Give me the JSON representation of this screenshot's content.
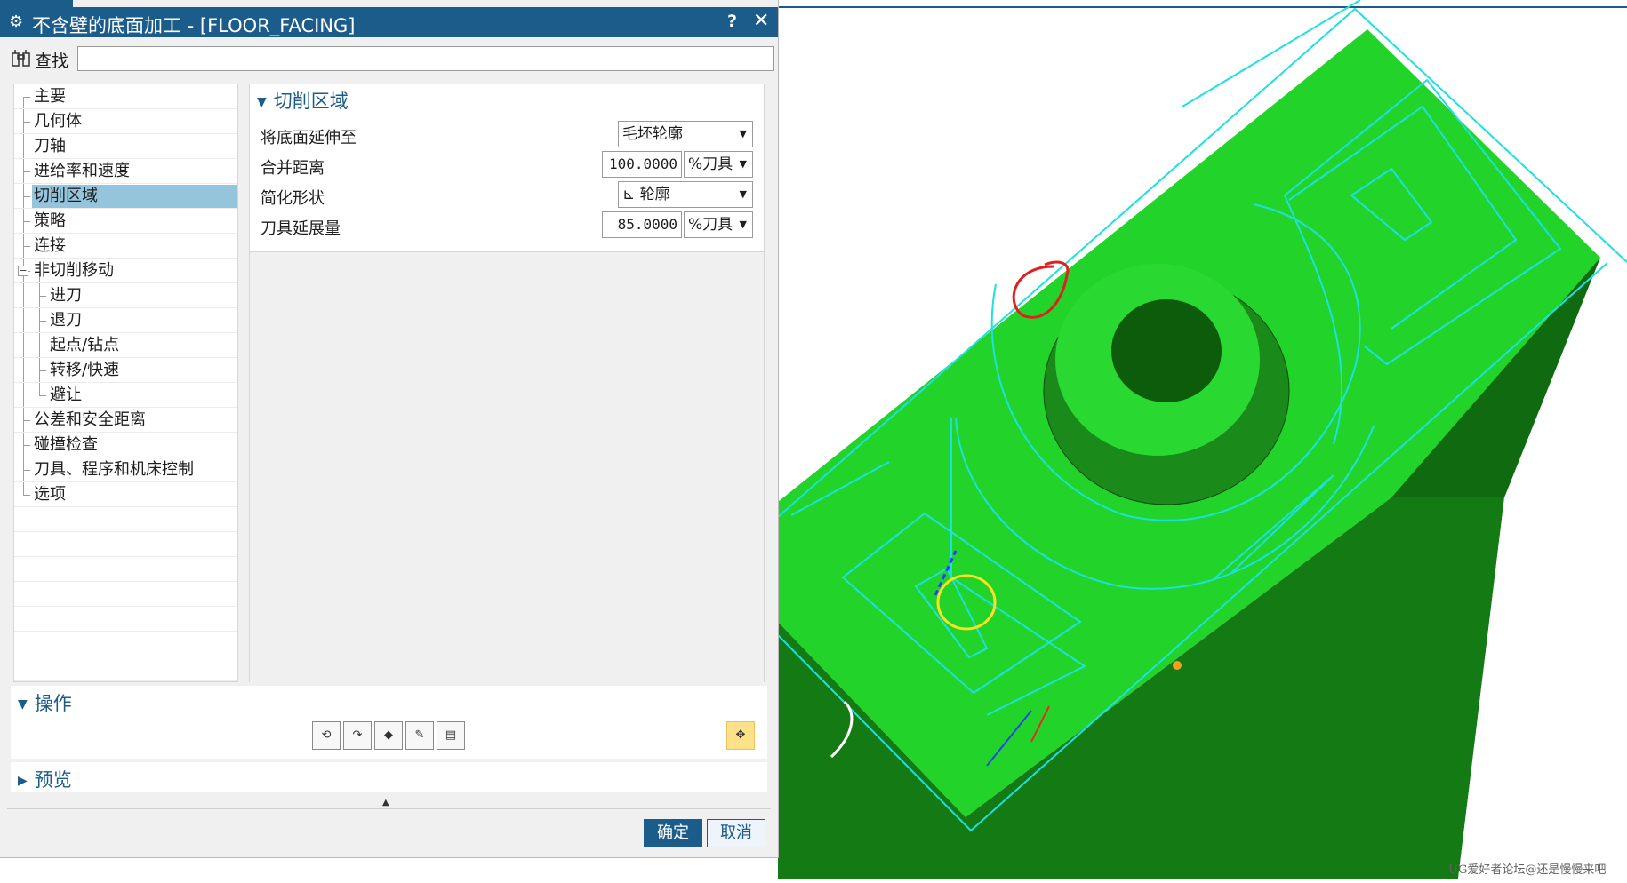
{
  "dialog": {
    "title": "不含壁的底面加工 - [FLOOR_FACING]",
    "help_label": "?",
    "close_label": "✕"
  },
  "find": {
    "label": "查找",
    "value": ""
  },
  "nav": {
    "items": [
      {
        "label": "主要",
        "level": 1
      },
      {
        "label": "几何体",
        "level": 1
      },
      {
        "label": "刀轴",
        "level": 1
      },
      {
        "label": "进给率和速度",
        "level": 1
      },
      {
        "label": "切削区域",
        "level": 1,
        "selected": true
      },
      {
        "label": "策略",
        "level": 1
      },
      {
        "label": "连接",
        "level": 1
      },
      {
        "label": "非切削移动",
        "level": 1,
        "expanded": true
      },
      {
        "label": "进刀",
        "level": 2
      },
      {
        "label": "退刀",
        "level": 2
      },
      {
        "label": "起点/钻点",
        "level": 2
      },
      {
        "label": "转移/快速",
        "level": 2
      },
      {
        "label": "避让",
        "level": 2
      },
      {
        "label": "公差和安全距离",
        "level": 1
      },
      {
        "label": "碰撞检查",
        "level": 1
      },
      {
        "label": "刀具、程序和机床控制",
        "level": 1
      },
      {
        "label": "选项",
        "level": 1
      }
    ]
  },
  "cut_region": {
    "header": "切削区域",
    "fields": {
      "extend_floor": {
        "label": "将底面延伸至",
        "value": "毛坯轮廓"
      },
      "merge_distance": {
        "label": "合并距离",
        "value": "100.0000",
        "unit": "%刀具"
      },
      "simplify_shape": {
        "label": "简化形状",
        "value": "轮廓"
      },
      "tool_extension": {
        "label": "刀具延展量",
        "value": "85.0000",
        "unit": "%刀具"
      }
    }
  },
  "actions": {
    "header": "操作",
    "buttons": [
      "generate-icon",
      "replay-icon",
      "verify-icon",
      "list-icon",
      "output-icon",
      "customize-icon"
    ]
  },
  "preview": {
    "header": "预览"
  },
  "footer": {
    "ok_label": "确定",
    "cancel_label": "取消"
  },
  "watermark": "UG爱好者论坛@还是慢慢来吧",
  "colors": {
    "title_bar": "#1c5c8a",
    "selection": "#94c5dc",
    "part": "#22d32a",
    "toolpath": "#1ee0e0"
  }
}
